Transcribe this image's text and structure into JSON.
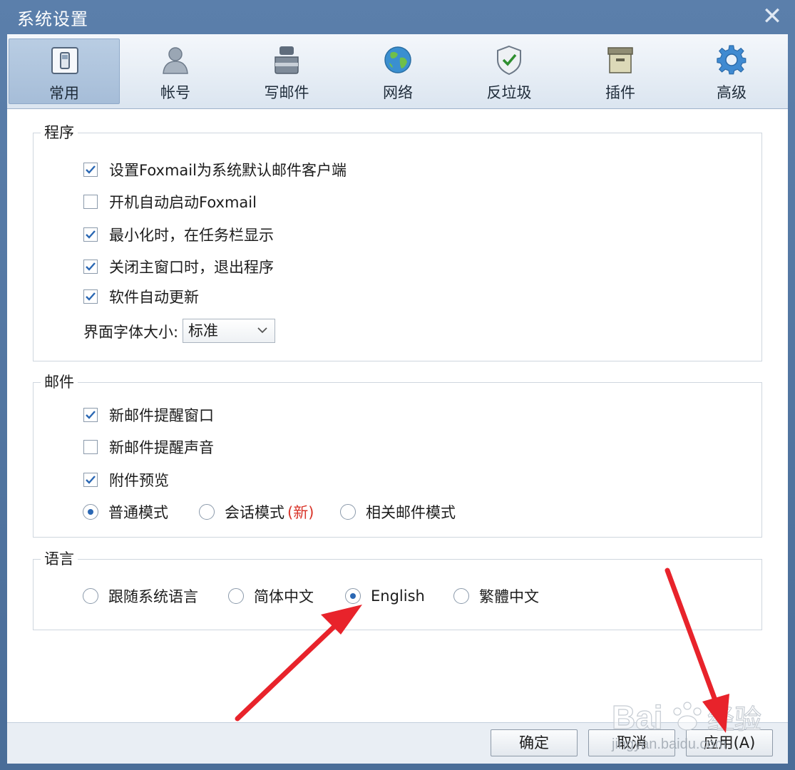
{
  "window": {
    "title": "系统设置",
    "close_glyph": "✕"
  },
  "toolbar": {
    "tabs": [
      {
        "label": "常用",
        "icon": "general-icon",
        "active": true
      },
      {
        "label": "帐号",
        "icon": "account-icon",
        "active": false
      },
      {
        "label": "写邮件",
        "icon": "compose-icon",
        "active": false
      },
      {
        "label": "网络",
        "icon": "globe-icon",
        "active": false
      },
      {
        "label": "反垃圾",
        "icon": "shield-icon",
        "active": false
      },
      {
        "label": "插件",
        "icon": "plugin-box-icon",
        "active": false
      },
      {
        "label": "高级",
        "icon": "gear-icon",
        "active": false
      }
    ]
  },
  "program": {
    "title": "程序",
    "options": [
      {
        "label": "设置Foxmail为系统默认邮件客户端",
        "checked": true
      },
      {
        "label": "开机自动启动Foxmail",
        "checked": false
      },
      {
        "label": "最小化时，在任务栏显示",
        "checked": true
      },
      {
        "label": "关闭主窗口时，退出程序",
        "checked": true
      },
      {
        "label": "软件自动更新",
        "checked": true
      }
    ],
    "font_size_label": "界面字体大小:",
    "font_size_value": "标准"
  },
  "mail": {
    "title": "邮件",
    "options": [
      {
        "label": "新邮件提醒窗口",
        "checked": true
      },
      {
        "label": "新邮件提醒声音",
        "checked": false
      },
      {
        "label": "附件预览",
        "checked": true
      }
    ],
    "modes": [
      {
        "label": "普通模式",
        "selected": true
      },
      {
        "label": "会话模式",
        "selected": false,
        "tag": "(新)"
      },
      {
        "label": "相关邮件模式",
        "selected": false
      }
    ]
  },
  "language": {
    "title": "语言",
    "options": [
      {
        "label": "跟随系统语言",
        "selected": false
      },
      {
        "label": "简体中文",
        "selected": false
      },
      {
        "label": "English",
        "selected": true
      },
      {
        "label": "繁體中文",
        "selected": false
      }
    ]
  },
  "footer": {
    "ok_label": "确定",
    "cancel_label": "取消",
    "apply_label": "应用(A)"
  },
  "overlay": {
    "watermark_text": "Baidu经验",
    "watermark_sub": "jingyan.baidu.com",
    "arrow_color": "#e8232b"
  }
}
